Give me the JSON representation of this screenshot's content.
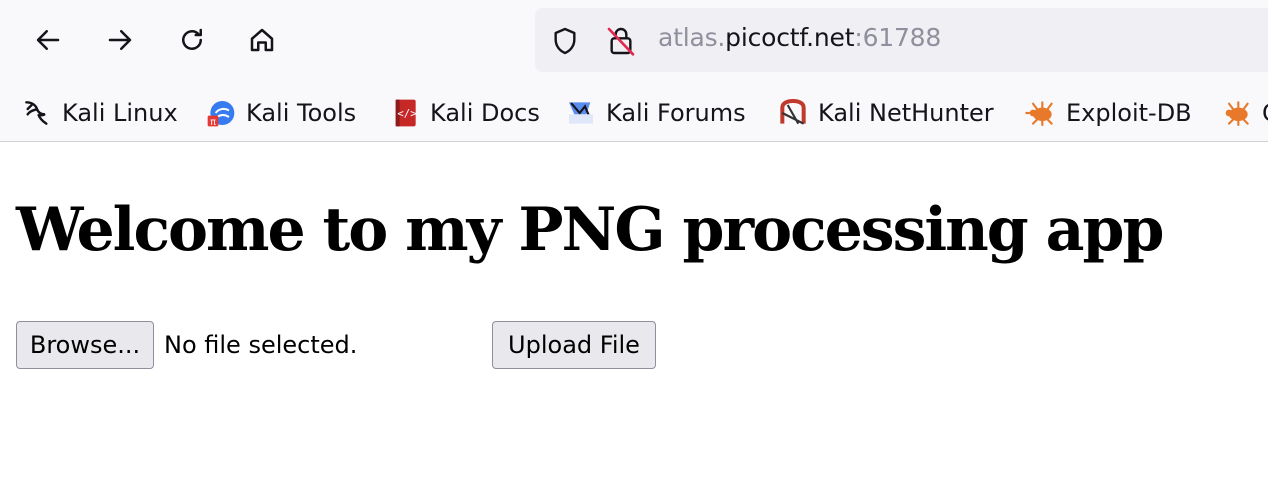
{
  "toolbar": {
    "back_icon": "arrow-left-icon",
    "forward_icon": "arrow-right-icon",
    "reload_icon": "reload-icon",
    "home_icon": "home-icon"
  },
  "urlbar": {
    "prefix": "atlas.",
    "host": "picoctf.net",
    "suffix": ":61788",
    "shield_icon": "shield-icon",
    "insecure_lock_icon": "insecure-lock-icon"
  },
  "bookmarks": [
    {
      "label": "Kali Linux",
      "icon": "kali-dragon-icon"
    },
    {
      "label": "Kali Tools",
      "icon": "kali-tools-icon"
    },
    {
      "label": "Kali Docs",
      "icon": "kali-docs-icon"
    },
    {
      "label": "Kali Forums",
      "icon": "kali-forums-icon"
    },
    {
      "label": "Kali NetHunter",
      "icon": "kali-nethunter-icon"
    },
    {
      "label": "Exploit-DB",
      "icon": "exploit-db-icon"
    },
    {
      "label": "G",
      "icon": "exploit-db-icon"
    }
  ],
  "page": {
    "heading": "Welcome to my PNG processing app",
    "browse_label": "Browse...",
    "file_status": "No file selected.",
    "upload_label": "Upload File"
  },
  "colors": {
    "toolbar_bg": "#f9f9fb",
    "urlbar_bg": "#f0f0f4",
    "url_dim": "#8f8f9d",
    "button_bg": "#e9e9ed",
    "exploit_orange": "#e8792a",
    "kali_red": "#c0392b",
    "kali_blue": "#367bf0"
  }
}
